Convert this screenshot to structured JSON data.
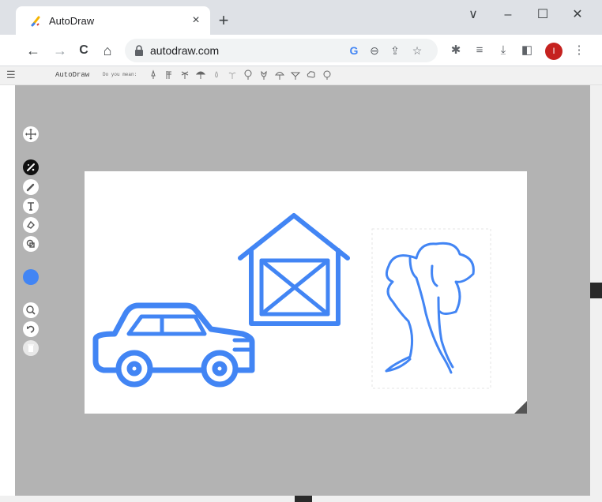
{
  "browser": {
    "tab_title": "AutoDraw",
    "tab_close": "×",
    "new_tab": "+",
    "window_controls": [
      "∨",
      "–",
      "☐",
      "✕"
    ],
    "nav": {
      "back": "←",
      "forward": "→",
      "reload": "C",
      "home": "⌂"
    },
    "url": "autodraw.com",
    "avatar_letter": "I"
  },
  "app": {
    "menu_icon": "hamburger-icon",
    "brand": "AutoDraw",
    "suggestion_prompt": "Do you mean:",
    "suggestions": [
      "lamp",
      "flag",
      "palm-tree",
      "umbrella",
      "drop",
      "sprout",
      "tree",
      "tulip",
      "tree",
      "tree",
      "cloud",
      "lollipop"
    ]
  },
  "tools": [
    "move-tool",
    "autodraw-tool",
    "draw-tool",
    "type-tool",
    "fill-tool",
    "shape-tool",
    "color-picker",
    "zoom-tool",
    "undo-tool",
    "delete-tool"
  ],
  "colors": {
    "accent": "#4285f4",
    "workspace": "#b3b3b3",
    "avatar": "#c5221f"
  }
}
